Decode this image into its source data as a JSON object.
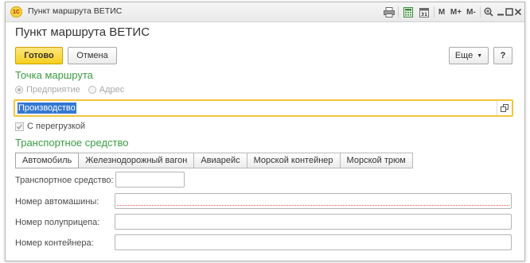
{
  "window": {
    "title": "Пункт маршрута ВЕТИС",
    "logo_text": "1С",
    "titlebar_icons": [
      "print-icon",
      "calc-icon",
      "calendar-icon",
      "memory-m-icon",
      "memory-m-plus-icon",
      "memory-m-minus-icon",
      "zoom-icon",
      "minimize-icon",
      "maximize-icon",
      "close-icon"
    ],
    "mem_labels": {
      "m": "M",
      "m_plus": "M+",
      "m_minus": "M-"
    }
  },
  "form": {
    "title": "Пункт маршрута ВЕТИС"
  },
  "toolbar": {
    "ok_label": "Готово",
    "cancel_label": "Отмена",
    "more_label": "Еще",
    "help_label": "?"
  },
  "route_point": {
    "header": "Точка маршрута",
    "options": [
      {
        "label": "Предприятие",
        "checked": true
      },
      {
        "label": "Адрес",
        "checked": false
      }
    ],
    "value": "Производство",
    "transshipment_label": "С перегрузкой",
    "transshipment_checked": true
  },
  "transport": {
    "header": "Транспортное средство",
    "tabs": [
      {
        "label": "Автомобиль",
        "active": true
      },
      {
        "label": "Железнодорожный вагон",
        "active": false
      },
      {
        "label": "Авиарейс",
        "active": false
      },
      {
        "label": "Морской контейнер",
        "active": false
      },
      {
        "label": "Морской трюм",
        "active": false
      }
    ],
    "fields": {
      "vehicle_label": "Транспортное средство:",
      "vehicle_value": "",
      "car_number_label": "Номер автомашины:",
      "car_number_value": "",
      "trailer_label": "Номер полуприцепа:",
      "trailer_value": "",
      "container_label": "Номер контейнера:",
      "container_value": ""
    }
  },
  "colors": {
    "accent_green": "#3b9c43",
    "primary_yellow": "#f6cf1c",
    "focus_border": "#f2c53d",
    "selection_blue": "#3478d3",
    "required_red": "#e05050"
  }
}
